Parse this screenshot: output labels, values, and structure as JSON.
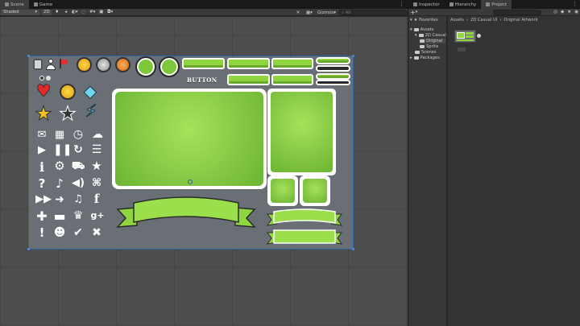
{
  "scene_tabs": [
    {
      "label": "Scene",
      "icon": "scene-icon"
    },
    {
      "label": "Game",
      "icon": "game-icon"
    }
  ],
  "scene_toolbar": {
    "shading_mode": "Shaded",
    "mode_2d": "2D",
    "gizmos_label": "Gizmos",
    "search_placeholder": "All"
  },
  "right_tabs": [
    {
      "label": "Inspector",
      "icon": "inspector-icon"
    },
    {
      "label": "Hierarchy",
      "icon": "hierarchy-icon"
    },
    {
      "label": "Project",
      "icon": "project-icon"
    }
  ],
  "project_toolbar": {
    "add_label": "+"
  },
  "project_tree": {
    "favorites_label": "Favorites",
    "items": [
      {
        "label": "Assets"
      },
      {
        "label": "2D Casual"
      },
      {
        "label": "Original"
      },
      {
        "label": "Sprite"
      },
      {
        "label": "Scenes"
      },
      {
        "label": "Packages"
      }
    ]
  },
  "breadcrumb": [
    "Assets",
    "2D Casual UI",
    "Original Artwork"
  ],
  "sprite_sheet": {
    "button_label": "BUTTON",
    "colors": {
      "accent_green": "#8ed540",
      "dark_green": "#6aa92d",
      "sheet_bg": "#6a6f75"
    }
  }
}
